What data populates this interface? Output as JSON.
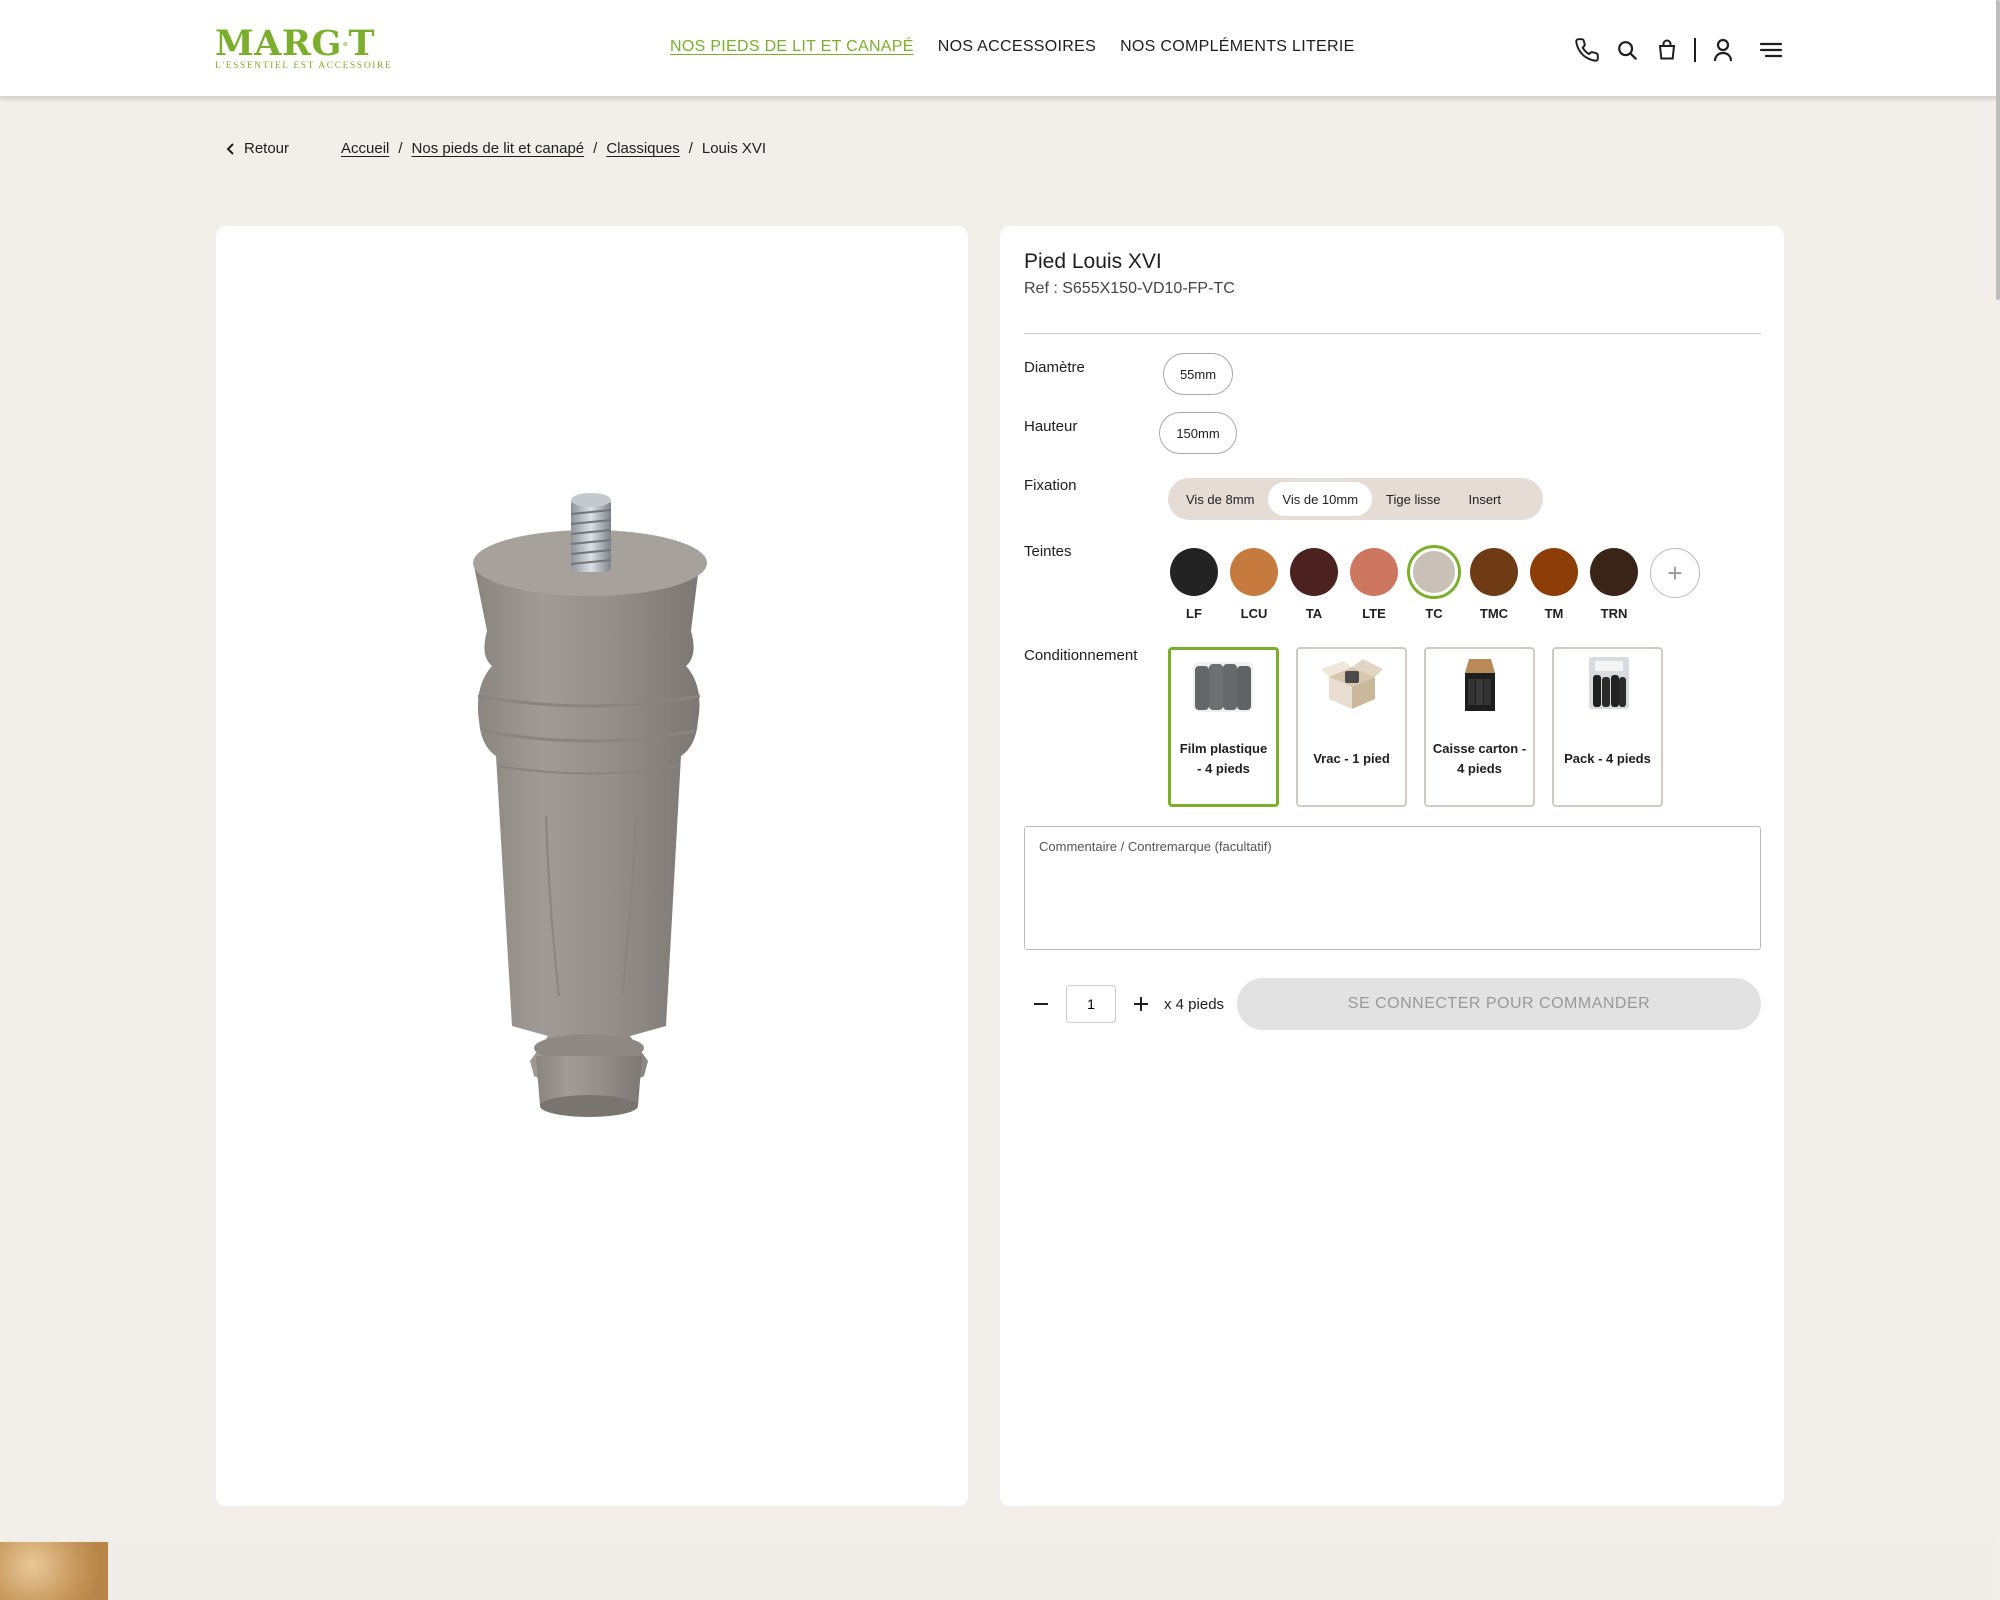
{
  "header": {
    "logo_prefix": "MARG",
    "logo_suffix": "T",
    "logo_tagline": "L'ESSENTIEL EST ACCESSOIRE",
    "nav": [
      {
        "label": "NOS PIEDS DE LIT ET CANAPÉ",
        "active": true
      },
      {
        "label": "NOS ACCESSOIRES",
        "active": false
      },
      {
        "label": "NOS COMPLÉMENTS LITERIE",
        "active": false
      }
    ],
    "icons": [
      "phone-icon",
      "search-icon",
      "cart-icon",
      "user-icon",
      "menu-icon"
    ]
  },
  "breadcrumb": {
    "back_label": "Retour",
    "items": [
      "Accueil",
      "Nos pieds de lit et canapé",
      "Classiques"
    ],
    "current": "Louis XVI"
  },
  "product": {
    "title": "Pied Louis XVI",
    "ref": "Ref : S655X150-VD10-FP-TC",
    "diameter": {
      "label": "Diamètre",
      "value": "55mm"
    },
    "height": {
      "label": "Hauteur",
      "value": "150mm"
    },
    "fixation": {
      "label": "Fixation",
      "options": [
        "Vis de 8mm",
        "Vis de 10mm",
        "Tige lisse",
        "Insert"
      ],
      "selected": "Vis de 10mm"
    },
    "tints": {
      "label": "Teintes",
      "selected": "TC",
      "items": [
        {
          "code": "LF",
          "color": "#232323"
        },
        {
          "code": "LCU",
          "color": "#c77a3e"
        },
        {
          "code": "TA",
          "color": "#4b2220"
        },
        {
          "code": "LTE",
          "color": "#cd7760"
        },
        {
          "code": "TC",
          "color": "#c9c0b8"
        },
        {
          "code": "TMC",
          "color": "#6e3b14"
        },
        {
          "code": "TM",
          "color": "#8c3d08"
        },
        {
          "code": "TRN",
          "color": "#3a2418"
        }
      ]
    },
    "packaging": {
      "label": "Conditionnement",
      "selected": "Film plastique - 4 pieds",
      "options": [
        "Film plastique - 4 pieds",
        "Vrac - 1 pied",
        "Caisse carton - 4 pieds",
        "Pack - 4 pieds"
      ]
    },
    "comment_placeholder": "Commentaire / Contremarque (facultatif)",
    "quantity": "1",
    "quantity_unit": "x 4 pieds",
    "order_button": "SE CONNECTER POUR COMMANDER"
  },
  "colors": {
    "brand_green": "#7cae2d",
    "background": "#f2efea"
  }
}
